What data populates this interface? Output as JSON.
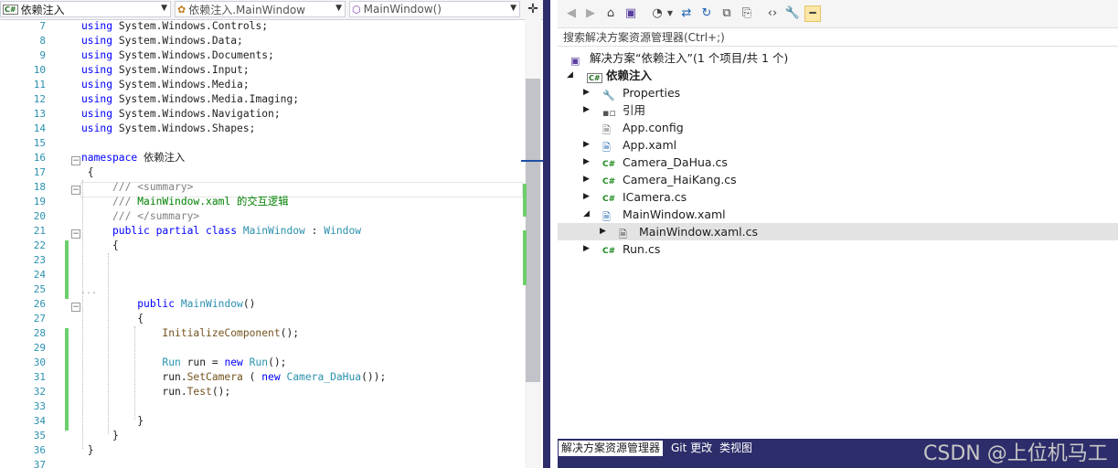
{
  "navbar": {
    "project_box": "依赖注入",
    "class_box": "依赖注入.MainWindow",
    "member_box": "MainWindow()"
  },
  "editor": {
    "lines": [
      {
        "n": "7",
        "parts": [
          [
            "kw",
            "using"
          ],
          [
            "ns",
            " System.Windows.Controls;"
          ]
        ]
      },
      {
        "n": "8",
        "parts": [
          [
            "kw",
            "using"
          ],
          [
            "ns",
            " System.Windows.Data;"
          ]
        ]
      },
      {
        "n": "9",
        "parts": [
          [
            "kw",
            "using"
          ],
          [
            "ns",
            " System.Windows.Documents;"
          ]
        ]
      },
      {
        "n": "10",
        "parts": [
          [
            "kw",
            "using"
          ],
          [
            "ns",
            " System.Windows.Input;"
          ]
        ]
      },
      {
        "n": "11",
        "parts": [
          [
            "kw",
            "using"
          ],
          [
            "ns",
            " System.Windows.Media;"
          ]
        ]
      },
      {
        "n": "12",
        "parts": [
          [
            "kw",
            "using"
          ],
          [
            "ns",
            " System.Windows.Media.Imaging;"
          ]
        ]
      },
      {
        "n": "13",
        "parts": [
          [
            "kw",
            "using"
          ],
          [
            "ns",
            " System.Windows.Navigation;"
          ]
        ]
      },
      {
        "n": "14",
        "parts": [
          [
            "kw",
            "using"
          ],
          [
            "ns",
            " System.Windows.Shapes;"
          ]
        ]
      },
      {
        "n": "15",
        "parts": []
      },
      {
        "n": "16",
        "parts": [
          [
            "kw",
            "namespace"
          ],
          [
            "ns",
            " 依赖注入"
          ]
        ]
      },
      {
        "n": "17",
        "parts": [
          [
            "ns",
            " {"
          ]
        ]
      },
      {
        "n": "18",
        "parts": [
          [
            "gr",
            "     /// <summary>"
          ]
        ]
      },
      {
        "n": "19",
        "parts": [
          [
            "gr",
            "     ///"
          ],
          [
            "cm",
            " MainWindow.xaml 的交互逻辑"
          ]
        ]
      },
      {
        "n": "20",
        "parts": [
          [
            "gr",
            "     /// </summary>"
          ]
        ]
      },
      {
        "n": "21",
        "parts": [
          [
            "kw",
            "     public partial class"
          ],
          [
            "ty",
            " MainWindow"
          ],
          [
            "ns",
            " : "
          ],
          [
            "ty",
            "Window"
          ]
        ]
      },
      {
        "n": "22",
        "parts": [
          [
            "ns",
            "     {"
          ]
        ]
      },
      {
        "n": "23",
        "parts": []
      },
      {
        "n": "24",
        "parts": []
      },
      {
        "n": "25",
        "parts": []
      },
      {
        "n": "26",
        "parts": [
          [
            "kw",
            "         public"
          ],
          [
            "ty",
            " MainWindow"
          ],
          [
            "ns",
            "()"
          ]
        ]
      },
      {
        "n": "27",
        "parts": [
          [
            "ns",
            "         {"
          ]
        ]
      },
      {
        "n": "28",
        "parts": [
          [
            "mt",
            "             InitializeComponent"
          ],
          [
            "ns",
            "();"
          ]
        ]
      },
      {
        "n": "29",
        "parts": []
      },
      {
        "n": "30",
        "parts": [
          [
            "ty",
            "             Run"
          ],
          [
            "ns",
            " run = "
          ],
          [
            "kw",
            "new"
          ],
          [
            "ty",
            " Run"
          ],
          [
            "ns",
            "();"
          ]
        ]
      },
      {
        "n": "31",
        "parts": [
          [
            "ns",
            "             run."
          ],
          [
            "mt",
            "SetCamera"
          ],
          [
            "ns",
            " ( "
          ],
          [
            "kw",
            "new"
          ],
          [
            "ty",
            " Camera_DaHua"
          ],
          [
            "ns",
            "());"
          ]
        ]
      },
      {
        "n": "32",
        "parts": [
          [
            "ns",
            "             run."
          ],
          [
            "mt",
            "Test"
          ],
          [
            "ns",
            "();"
          ]
        ]
      },
      {
        "n": "33",
        "parts": []
      },
      {
        "n": "34",
        "parts": [
          [
            "ns",
            "         }"
          ]
        ]
      },
      {
        "n": "35",
        "parts": [
          [
            "ns",
            "     }"
          ]
        ]
      },
      {
        "n": "36",
        "parts": [
          [
            "ns",
            " }"
          ]
        ]
      },
      {
        "n": "37",
        "parts": []
      }
    ],
    "ellipsis": "..."
  },
  "explorer": {
    "search_placeholder": "搜索解决方案资源管理器(Ctrl+;)",
    "solution_label": "解决方案“依赖注入”(1 个项目/共 1 个)",
    "project_label": "依赖注入",
    "items": [
      {
        "label": "Properties",
        "icon": "wrench-icon"
      },
      {
        "label": "引用",
        "icon": "references-icon"
      },
      {
        "label": "App.config",
        "icon": "config-file-icon"
      },
      {
        "label": "App.xaml",
        "icon": "xaml-file-icon"
      },
      {
        "label": "Camera_DaHua.cs",
        "icon": "csharp-file-icon"
      },
      {
        "label": "Camera_HaiKang.cs",
        "icon": "csharp-file-icon"
      },
      {
        "label": "ICamera.cs",
        "icon": "csharp-file-icon"
      },
      {
        "label": "MainWindow.xaml",
        "icon": "xaml-file-icon"
      },
      {
        "label": "MainWindow.xaml.cs",
        "icon": "code-file-icon"
      },
      {
        "label": "Run.cs",
        "icon": "csharp-file-icon"
      }
    ],
    "tabs": [
      "解决方案资源管理器",
      "Git 更改",
      "类视图"
    ]
  },
  "watermark": "CSDN @上位机马工",
  "colors": {
    "accent": "#2d2d6b",
    "keyword": "#0000ff",
    "type": "#2b91af",
    "comment": "#008000",
    "change_marker": "#6ccf6c"
  }
}
